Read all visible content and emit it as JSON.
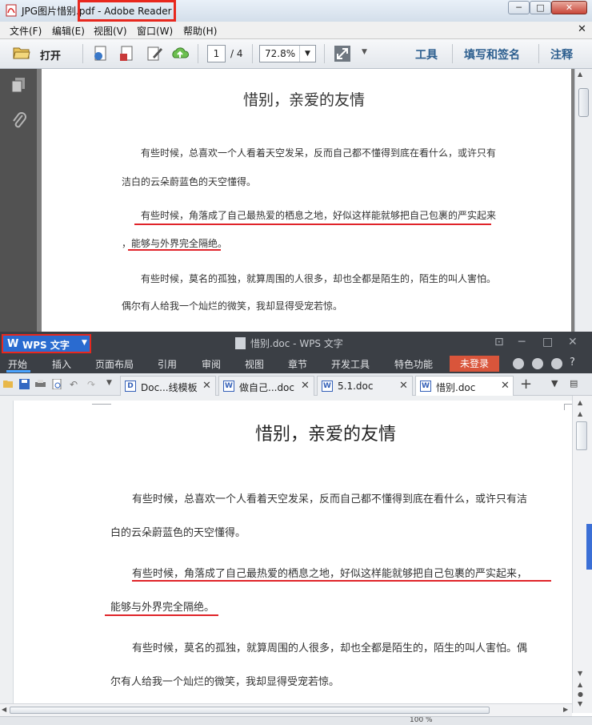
{
  "reader": {
    "title": "JPG图片惜别.pdf - Adobe Reader",
    "window_controls": {
      "minimize": "─",
      "maximize": "□",
      "close": "✕"
    },
    "menu": [
      "文件(F)",
      "编辑(E)",
      "视图(V)",
      "窗口(W)",
      "帮助(H)"
    ],
    "menu_close": "✕",
    "toolbar": {
      "open_label": "打开",
      "page_current": "1",
      "page_total": "/ 4",
      "zoom": "72.8%",
      "tools_label": "工具",
      "fill_sign_label": "填写和签名",
      "comment_label": "注释"
    },
    "page": {
      "title": "惜别，亲爱的友情",
      "lines": [
        "有些时候，总喜欢一个人看着天空发呆，反而自己都不懂得到底在看什么，或许只有",
        "洁白的云朵蔚蓝色的天空懂得。",
        "有些时候，角落成了自己最热爱的栖息之地，好似这样能就够把自己包裹的严实起来",
        "，能够与外界完全隔绝。",
        "有些时候，莫名的孤独，就算周围的人很多，却也全都是陌生的，陌生的叫人害怕。",
        "偶尔有人给我一个灿烂的微笑，我却显得受宠若惊。"
      ]
    }
  },
  "wps": {
    "app_label": "WPS 文字",
    "title": "惜别.doc - WPS 文字",
    "ribbon_tabs": [
      "开始",
      "插入",
      "页面布局",
      "引用",
      "审阅",
      "视图",
      "章节",
      "开发工具",
      "特色功能"
    ],
    "login_label": "未登录",
    "help_label": "?",
    "doc_tabs": [
      {
        "label": "Doc...线模板",
        "icon": "D"
      },
      {
        "label": "做自己...doc",
        "icon": "W"
      },
      {
        "label": "5.1.doc",
        "icon": "W"
      },
      {
        "label": "惜别.doc",
        "icon": "W"
      }
    ],
    "page": {
      "title": "惜别，亲爱的友情",
      "lines": [
        "有些时候，总喜欢一个人看着天空发呆，反而自己都不懂得到底在看什么，或许只有洁",
        "白的云朵蔚蓝色的天空懂得。",
        "有些时候，角落成了自己最热爱的栖息之地，好似这样能就够把自己包裹的严实起来，",
        "能够与外界完全隔绝。",
        "有些时候，莫名的孤独，就算周围的人很多，却也全都是陌生的，陌生的叫人害怕。偶",
        "尔有人给我一个灿烂的微笑，我却显得受宠若惊。"
      ]
    },
    "status_zoom": "100 %"
  },
  "colors": {
    "highlight_box": "#e8281e",
    "underline": "#e0242a",
    "wps_blue": "#2a6bd0",
    "login_bg": "#d9553b"
  }
}
